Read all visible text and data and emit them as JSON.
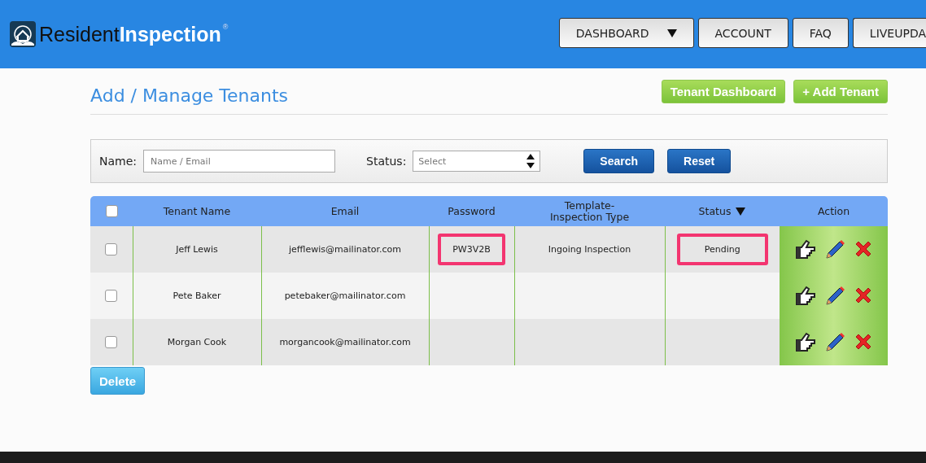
{
  "header": {
    "logo": {
      "name_dark": "Resident",
      "name_light": "Inspection",
      "mark": "®"
    },
    "nav": [
      {
        "label": "DASHBOARD",
        "dropdown": true
      },
      {
        "label": "ACCOUNT",
        "dropdown": false
      },
      {
        "label": "FAQ",
        "dropdown": false
      },
      {
        "label": "LIVEUPDA",
        "dropdown": false
      }
    ]
  },
  "page": {
    "title": "Add / Manage Tenants",
    "buttons": [
      "Tenant Dashboard",
      "+ Add Tenant"
    ]
  },
  "filter": {
    "name_label": "Name:",
    "name_placeholder": "Name / Email",
    "status_label": "Status:",
    "status_value": "Select",
    "buttons": [
      "Search",
      "Reset"
    ]
  },
  "table": {
    "select_all_checked": false,
    "columns": [
      {
        "label": "Tenant Name",
        "sortable": false
      },
      {
        "label": "Email",
        "sortable": false
      },
      {
        "label": "Password",
        "sortable": false
      },
      {
        "label": "Template-\nInspection Type",
        "sortable": false
      },
      {
        "label": "Status",
        "sortable": true
      },
      {
        "label": "Action",
        "sortable": false
      }
    ],
    "rows": [
      {
        "checked": false,
        "name": "Jeff Lewis",
        "email": "jefflewis@mailinator.com",
        "password": "PW3V2B",
        "password_highlighted": true,
        "template": "Ingoing Inspection",
        "status": "Pending",
        "status_highlighted": true
      },
      {
        "checked": false,
        "name": "Pete Baker",
        "email": "petebaker@mailinator.com",
        "password": "",
        "password_highlighted": false,
        "template": "",
        "status": "",
        "status_highlighted": false
      },
      {
        "checked": false,
        "name": "Morgan Cook",
        "email": "morgancook@mailinator.com",
        "password": "",
        "password_highlighted": false,
        "template": "",
        "status": "",
        "status_highlighted": false
      }
    ]
  },
  "delete_button": "Delete"
}
